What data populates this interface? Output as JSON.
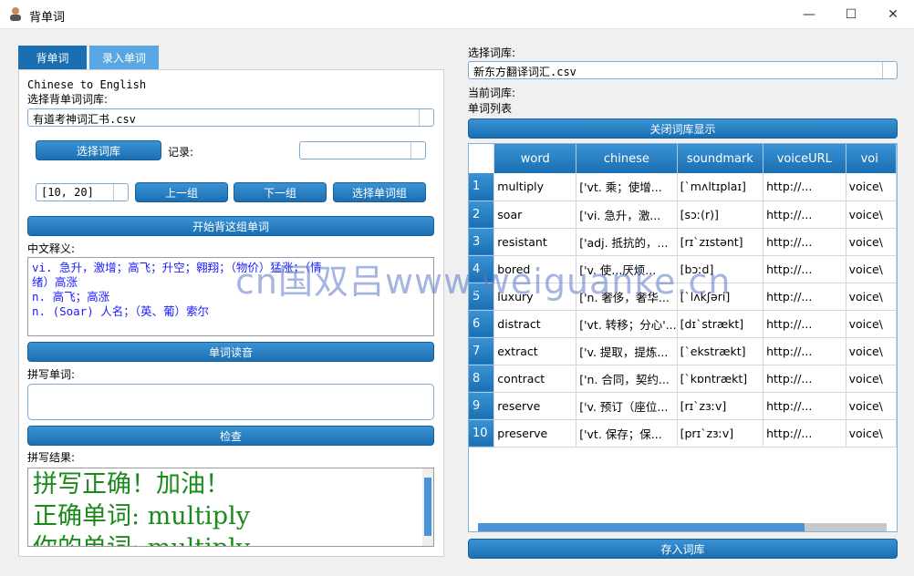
{
  "window": {
    "title": "背单词",
    "minimize": "—",
    "maximize": "☐",
    "close": "✕"
  },
  "tabs": [
    {
      "label": "背单词",
      "active": false
    },
    {
      "label": "录入单词",
      "active": true
    }
  ],
  "left": {
    "mode_text": "Chinese to English",
    "choose_dict_label": "选择背单词词库:",
    "dict_value": "有道考神词汇书.csv",
    "choose_dict_button": "选择词库",
    "record_label": "记录:",
    "record_value": "",
    "range_value": "[10, 20]",
    "prev_group_button": "上一组",
    "next_group_button": "下一组",
    "choose_group_button": "选择单词组",
    "start_button": "开始背这组单词",
    "meaning_label": "中文释义:",
    "meaning_lines": [
      "vi. 急升，激增；高飞；升空；翱翔；（物价）猛涨；（情",
      "绪）高涨",
      "n. 高飞；高涨",
      "n. (Soar) 人名；（英、葡）索尔"
    ],
    "read_button": "单词读音",
    "spell_label": "拼写单词:",
    "spell_value": "",
    "check_button": "检查",
    "result_label": "拼写结果:",
    "result_lines": [
      "拼写正确！加油！",
      "正确单词: multiply",
      "你的单词: multiply"
    ]
  },
  "right": {
    "choose_dict_label": "选择词库:",
    "dict_value": "新东方翻译词汇.csv",
    "current_dict_label": "当前词库:",
    "word_list_label": "单词列表",
    "close_display_button": "关闭词库显示",
    "save_button": "存入词库",
    "table": {
      "columns": [
        "word",
        "chinese",
        "soundmark",
        "voiceURL",
        "voi"
      ],
      "rows": [
        {
          "n": "1",
          "word": "multiply",
          "chinese": "['vt. 乘；使增...",
          "soundmark": "[ˋmʌltɪplaɪ]",
          "voiceURL": "http://...",
          "voice": "voice\\"
        },
        {
          "n": "2",
          "word": "soar",
          "chinese": "['vi. 急升，激...",
          "soundmark": "[sɔː(r)]",
          "voiceURL": "http://...",
          "voice": "voice\\"
        },
        {
          "n": "3",
          "word": "resistant",
          "chinese": "['adj. 抵抗的，...",
          "soundmark": "[rɪˋzɪstənt]",
          "voiceURL": "http://...",
          "voice": "voice\\"
        },
        {
          "n": "4",
          "word": "bored",
          "chinese": "['v. 使...厌烦...",
          "soundmark": "[bɔːd]",
          "voiceURL": "http://...",
          "voice": "voice\\"
        },
        {
          "n": "5",
          "word": "luxury",
          "chinese": "['n. 奢侈，奢华...",
          "soundmark": "[ˋlʌkʃəri]",
          "voiceURL": "http://...",
          "voice": "voice\\"
        },
        {
          "n": "6",
          "word": "distract",
          "chinese": "['vt. 转移；分心'...",
          "soundmark": "[dɪˋstrækt]",
          "voiceURL": "http://...",
          "voice": "voice\\"
        },
        {
          "n": "7",
          "word": "extract",
          "chinese": "['v. 提取，提炼...",
          "soundmark": "[ˋekstrækt]",
          "voiceURL": "http://...",
          "voice": "voice\\"
        },
        {
          "n": "8",
          "word": "contract",
          "chinese": "['n. 合同，契约...",
          "soundmark": "[ˋkɒntrækt]",
          "voiceURL": "http://...",
          "voice": "voice\\"
        },
        {
          "n": "9",
          "word": "reserve",
          "chinese": "['v. 预订（座位...",
          "soundmark": "[rɪˋzɜːv]",
          "voiceURL": "http://...",
          "voice": "voice\\"
        },
        {
          "n": "10",
          "word": "preserve",
          "chinese": "['vt. 保存；保...",
          "soundmark": "[prɪˋzɜːv]",
          "voiceURL": "http://...",
          "voice": "voice\\"
        }
      ]
    }
  },
  "watermark": "cn国双吕www.weiguanke.cn",
  "colors": {
    "accent": "#1a6fb2",
    "accent_light": "#3a93d4",
    "meaning_text": "#1a1aff",
    "result_text": "#1b8a1b"
  }
}
